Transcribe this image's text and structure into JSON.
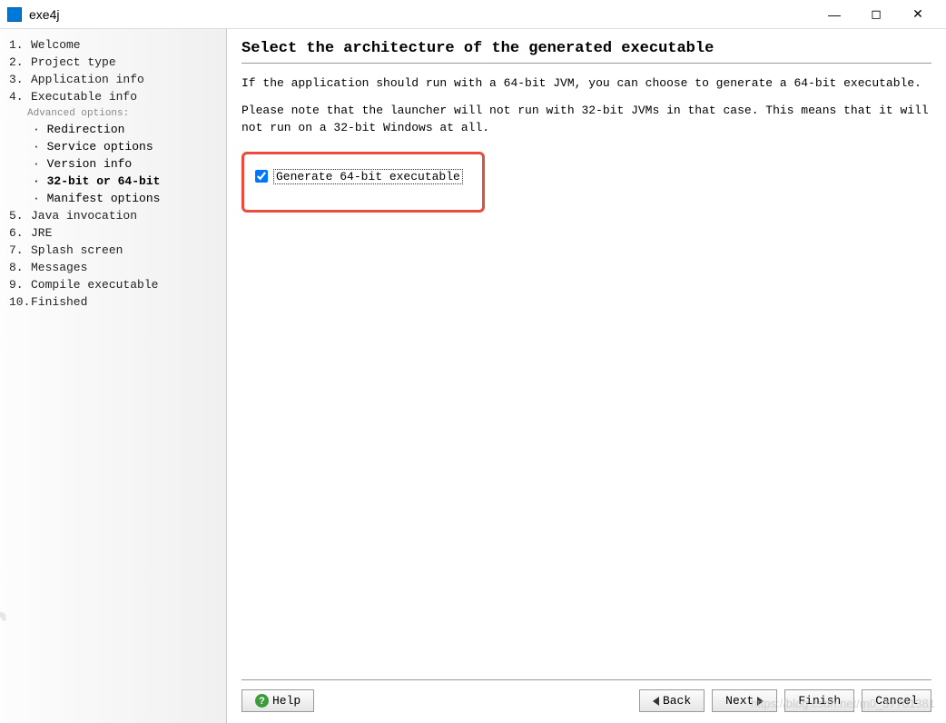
{
  "window": {
    "title": "exe4j",
    "brand": "exe4j"
  },
  "sidebar": {
    "advanced_header": "Advanced options:",
    "steps": [
      {
        "num": "1.",
        "label": "Welcome"
      },
      {
        "num": "2.",
        "label": "Project type"
      },
      {
        "num": "3.",
        "label": "Application info"
      },
      {
        "num": "4.",
        "label": "Executable info"
      },
      {
        "num": "5.",
        "label": "Java invocation"
      },
      {
        "num": "6.",
        "label": "JRE"
      },
      {
        "num": "7.",
        "label": "Splash screen"
      },
      {
        "num": "8.",
        "label": "Messages"
      },
      {
        "num": "9.",
        "label": "Compile executable"
      },
      {
        "num": "10.",
        "label": "Finished"
      }
    ],
    "substeps": [
      {
        "label": "Redirection"
      },
      {
        "label": "Service options"
      },
      {
        "label": "Version info"
      },
      {
        "label": "32-bit or 64-bit"
      },
      {
        "label": "Manifest options"
      }
    ]
  },
  "main": {
    "heading": "Select the architecture of the generated executable",
    "desc1": "If the application should run with a 64-bit JVM, you can choose to generate a 64-bit executable.",
    "desc2": "Please note that the launcher will not run with 32-bit JVMs in that case. This means that it will not run on a 32-bit Windows at all.",
    "checkbox_label": "Generate 64-bit executable",
    "checkbox_checked": true
  },
  "footer": {
    "help": "Help",
    "back": "Back",
    "next": "Next",
    "finish": "Finish",
    "cancel": "Cancel"
  },
  "watermark": "https://blog.csdn.net/m0_37701381"
}
